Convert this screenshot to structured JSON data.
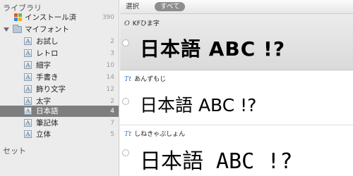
{
  "sidebar": {
    "library_title": "ライブラリ",
    "installed": {
      "label": "インストール済",
      "count": "390"
    },
    "my_fonts": {
      "label": "マイフォント"
    },
    "collections": [
      {
        "label": "お試し",
        "count": "2"
      },
      {
        "label": "レトロ",
        "count": "3"
      },
      {
        "label": "細字",
        "count": "10"
      },
      {
        "label": "手書き",
        "count": "14"
      },
      {
        "label": "飾り文字",
        "count": "12"
      },
      {
        "label": "太字",
        "count": "2"
      },
      {
        "label": "日本語",
        "count": "4",
        "selected": true
      },
      {
        "label": "筆記体",
        "count": "7"
      },
      {
        "label": "立体",
        "count": "5"
      }
    ],
    "sets_title": "セット"
  },
  "toolbar": {
    "select_label": "選択",
    "all_label": "すべて"
  },
  "previews": [
    {
      "icon": "O",
      "name": "KFひま字",
      "sample": "日本語 ABC !?"
    },
    {
      "icon": "Tt",
      "name": "あんずもじ",
      "sample": "日本語 ABC !?"
    },
    {
      "icon": "Tt",
      "name": "しねきゃぷしょん",
      "sample": "日本語 ABC !?"
    }
  ],
  "colors": {
    "selected_row": "#7e7e7e",
    "sidebar_bg": "#ececec",
    "folder_blue": "#b9c9d6"
  }
}
